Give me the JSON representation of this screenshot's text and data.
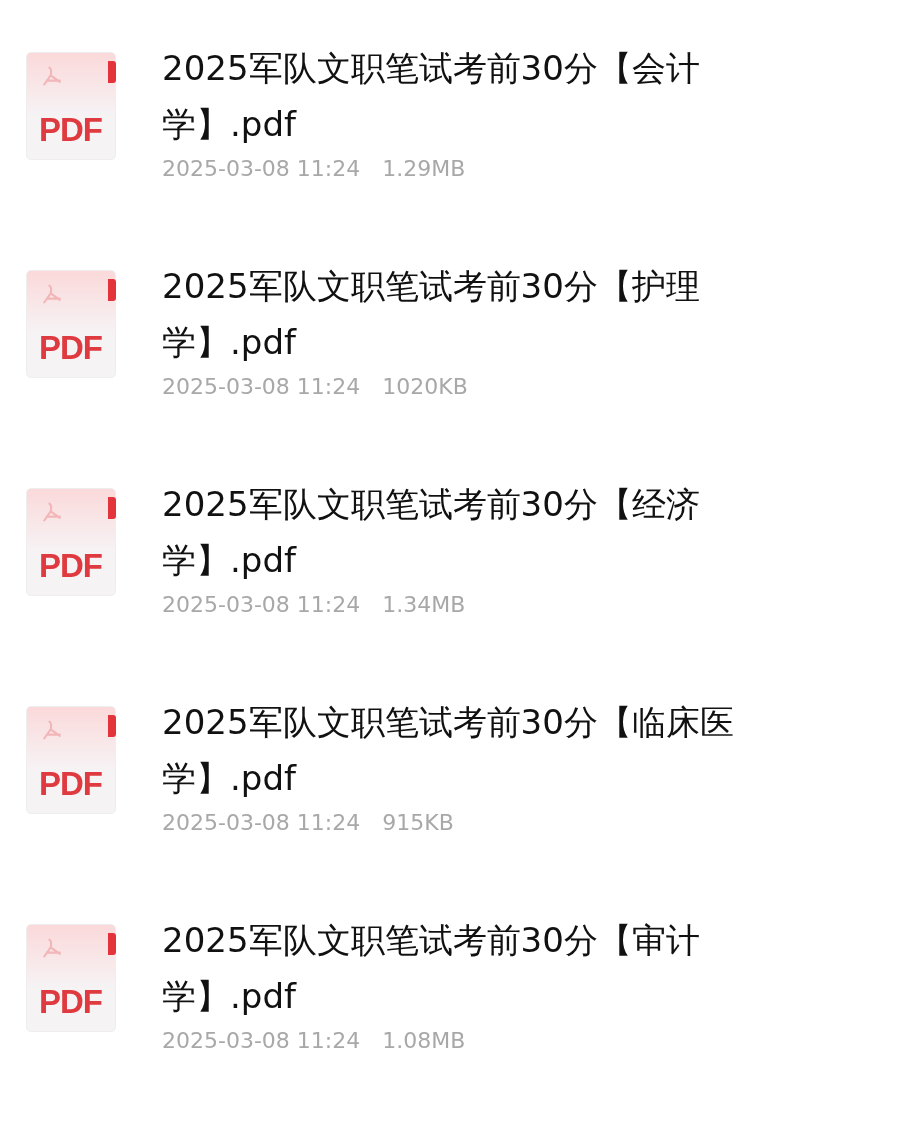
{
  "files": [
    {
      "kind": "pdf",
      "icon_label": "PDF",
      "name": "2025军队文职笔试考前30分【会计学】.pdf",
      "date": "2025-03-08 11:24",
      "size": "1.29MB"
    },
    {
      "kind": "pdf",
      "icon_label": "PDF",
      "name": "2025军队文职笔试考前30分【护理学】.pdf",
      "date": "2025-03-08 11:24",
      "size": "1020KB"
    },
    {
      "kind": "pdf",
      "icon_label": "PDF",
      "name": "2025军队文职笔试考前30分【经济学】.pdf",
      "date": "2025-03-08 11:24",
      "size": "1.34MB"
    },
    {
      "kind": "pdf",
      "icon_label": "PDF",
      "name": "2025军队文职笔试考前30分【临床医学】.pdf",
      "date": "2025-03-08 11:24",
      "size": "915KB"
    },
    {
      "kind": "pdf",
      "icon_label": "PDF",
      "name": "2025军队文职笔试考前30分【审计学】.pdf",
      "date": "2025-03-08 11:24",
      "size": "1.08MB"
    }
  ]
}
